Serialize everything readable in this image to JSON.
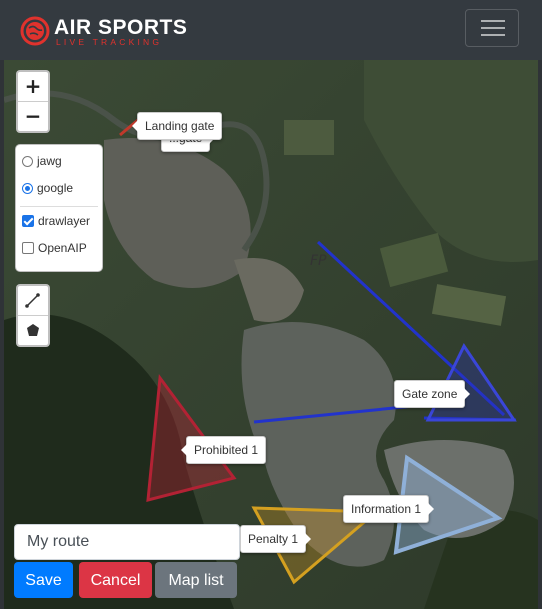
{
  "brand": {
    "title": "AIR SPORTS",
    "subtitle": "LIVE TRACKING"
  },
  "map_controls": {
    "zoom_in": "+",
    "zoom_out": "−"
  },
  "layers": {
    "base": [
      {
        "label": "jawg",
        "selected": false
      },
      {
        "label": "google",
        "selected": true
      }
    ],
    "overlays": [
      {
        "label": "drawlayer",
        "checked": true
      },
      {
        "label": "OpenAIP",
        "checked": false
      }
    ]
  },
  "map_labels": {
    "landing_gate": "Landing gate",
    "hidden_gate": "...gate",
    "fp": "FP",
    "gate_zone": "Gate zone",
    "prohibited": "Prohibited 1",
    "information": "Information 1",
    "penalty": "Penalty 1"
  },
  "zone_colors": {
    "prohibited": "#b22234",
    "penalty": "#e0a020",
    "information": "#8fb0d8",
    "gate": "#2233cc"
  },
  "form": {
    "route_name_value": "My route",
    "save_label": "Save",
    "cancel_label": "Cancel",
    "map_list_label": "Map list"
  }
}
